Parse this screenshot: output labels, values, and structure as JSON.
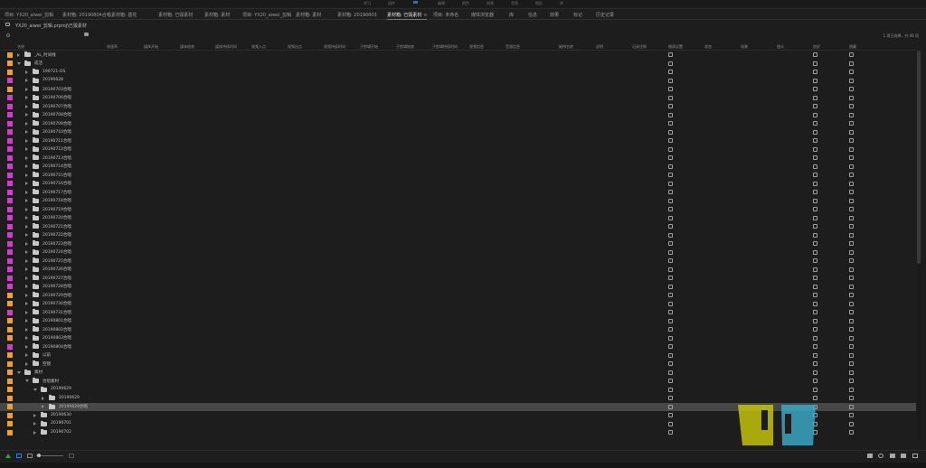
{
  "workspaces": {
    "items": [
      "学习",
      "组件",
      "编辑",
      "颜色",
      "效果",
      "音频",
      "图形",
      "库"
    ]
  },
  "tabs": [
    {
      "label": "项目: YX20_aiwei_剪辑",
      "active": false
    },
    {
      "label": "素材箱: 20190804合唱",
      "active": false
    },
    {
      "label": "素材箱: 插花",
      "active": false
    },
    {
      "label": "素材箱: 已毁素材",
      "active": false
    },
    {
      "label": "素材箱: 素材",
      "active": false
    },
    {
      "label": "项目: YX20_aiwei_剪辑",
      "active": false
    },
    {
      "label": "素材箱: 素材",
      "active": false
    },
    {
      "label": "素材箱: 20190803",
      "active": false
    },
    {
      "label": "素材箱: 已毁素材",
      "active": true
    },
    {
      "label": "项目: 未命名",
      "active": false
    },
    {
      "label": "媒体浏览器",
      "active": false
    },
    {
      "label": "库",
      "active": false
    },
    {
      "label": "信息",
      "active": false
    },
    {
      "label": "效果",
      "active": false
    },
    {
      "label": "标记",
      "active": false
    },
    {
      "label": "历史记录",
      "active": false
    }
  ],
  "close_glyph": "≡",
  "path": {
    "text": "YX20_aiwei_剪辑.prproj\\已毁素材"
  },
  "selection_info": "1 项已选择，共 46 项",
  "columns": [
    "名称",
    "帧速率",
    "媒体开始",
    "媒体结束",
    "媒体持续时间",
    "视频入点",
    "视频出点",
    "视频持续时间",
    "子剪辑开始",
    "子剪辑结束",
    "子剪辑持续时间",
    "视频信息",
    "音频信息",
    "磁带名称",
    "说明",
    "记录注释",
    "捕获设置",
    "状态",
    "场景",
    "镜头",
    "良好",
    "隐藏"
  ],
  "colors": {
    "orange": "#f0a030",
    "magenta": "#d63bd1",
    "selected_row": "#474747",
    "logo_yellow": "#c8c80a",
    "logo_cyan": "#3aa9c9"
  },
  "rows": [
    {
      "name": "_AL_时间线",
      "level": 0,
      "open": false,
      "color": "orange"
    },
    {
      "name": "成活",
      "level": 0,
      "open": true,
      "color": "orange"
    },
    {
      "name": "190721-OS",
      "level": 1,
      "open": false,
      "color": "orange"
    },
    {
      "name": "20190628",
      "level": 1,
      "open": false,
      "color": "magenta"
    },
    {
      "name": "20190703合唱",
      "level": 1,
      "open": false,
      "color": "orange"
    },
    {
      "name": "20190706合唱",
      "level": 1,
      "open": false,
      "color": "magenta"
    },
    {
      "name": "20190707合唱",
      "level": 1,
      "open": false,
      "color": "magenta"
    },
    {
      "name": "20190708合唱",
      "level": 1,
      "open": false,
      "color": "magenta"
    },
    {
      "name": "20190709合唱",
      "level": 1,
      "open": false,
      "color": "magenta"
    },
    {
      "name": "20190710合唱",
      "level": 1,
      "open": false,
      "color": "magenta"
    },
    {
      "name": "20190711合唱",
      "level": 1,
      "open": false,
      "color": "magenta"
    },
    {
      "name": "20190712合唱",
      "level": 1,
      "open": false,
      "color": "magenta"
    },
    {
      "name": "20190713合唱",
      "level": 1,
      "open": false,
      "color": "magenta"
    },
    {
      "name": "20190714合唱",
      "level": 1,
      "open": false,
      "color": "magenta"
    },
    {
      "name": "20190715合唱",
      "level": 1,
      "open": false,
      "color": "magenta"
    },
    {
      "name": "20190716合唱",
      "level": 1,
      "open": false,
      "color": "magenta"
    },
    {
      "name": "20190717合唱",
      "level": 1,
      "open": false,
      "color": "magenta"
    },
    {
      "name": "20190718合唱",
      "level": 1,
      "open": false,
      "color": "magenta"
    },
    {
      "name": "20190719合唱",
      "level": 1,
      "open": false,
      "color": "magenta"
    },
    {
      "name": "20190720合唱",
      "level": 1,
      "open": false,
      "color": "magenta"
    },
    {
      "name": "20190721合唱",
      "level": 1,
      "open": false,
      "color": "magenta"
    },
    {
      "name": "20190722合唱",
      "level": 1,
      "open": false,
      "color": "magenta"
    },
    {
      "name": "20190723合唱",
      "level": 1,
      "open": false,
      "color": "magenta"
    },
    {
      "name": "20190724合唱",
      "level": 1,
      "open": false,
      "color": "magenta"
    },
    {
      "name": "20190725合唱",
      "level": 1,
      "open": false,
      "color": "magenta"
    },
    {
      "name": "20190726合唱",
      "level": 1,
      "open": false,
      "color": "magenta"
    },
    {
      "name": "20190727合唱",
      "level": 1,
      "open": false,
      "color": "magenta"
    },
    {
      "name": "20190728合唱",
      "level": 1,
      "open": false,
      "color": "magenta"
    },
    {
      "name": "20190729合唱",
      "level": 1,
      "open": false,
      "color": "orange"
    },
    {
      "name": "20190730合唱",
      "level": 1,
      "open": false,
      "color": "orange"
    },
    {
      "name": "20190731合唱",
      "level": 1,
      "open": false,
      "color": "magenta"
    },
    {
      "name": "20190801合唱",
      "level": 1,
      "open": false,
      "color": "orange"
    },
    {
      "name": "20190802合唱",
      "level": 1,
      "open": false,
      "color": "orange"
    },
    {
      "name": "20190803合唱",
      "level": 1,
      "open": false,
      "color": "orange"
    },
    {
      "name": "20190804合唱",
      "level": 1,
      "open": false,
      "color": "magenta"
    },
    {
      "name": "以前",
      "level": 1,
      "open": false,
      "color": "orange"
    },
    {
      "name": "空镜",
      "level": 1,
      "open": false,
      "color": "orange"
    },
    {
      "name": "素材",
      "level": 0,
      "open": true,
      "color": "orange"
    },
    {
      "name": "合唱素材",
      "level": 1,
      "open": true,
      "color": "orange"
    },
    {
      "name": "20190629",
      "level": 2,
      "open": true,
      "color": "orange"
    },
    {
      "name": "20190629",
      "level": 3,
      "open": false,
      "color": "orange"
    },
    {
      "name": "20190629合唱",
      "level": 3,
      "open": false,
      "color": "orange",
      "selected": true
    },
    {
      "name": "20190630",
      "level": 2,
      "open": false,
      "color": "orange"
    },
    {
      "name": "20190701",
      "level": 2,
      "open": false,
      "color": "orange"
    },
    {
      "name": "20190702",
      "level": 2,
      "open": false,
      "color": "orange"
    }
  ]
}
